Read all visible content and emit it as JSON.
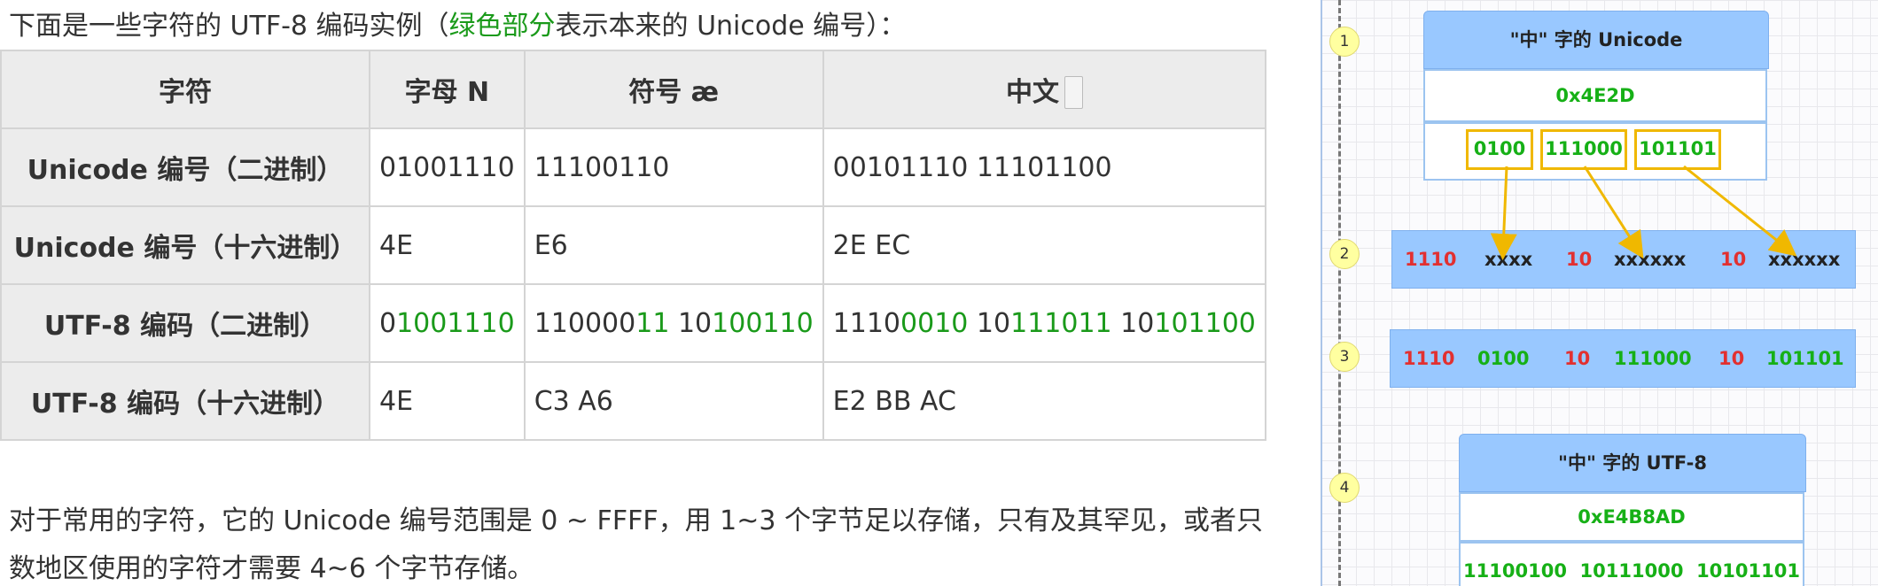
{
  "intro": {
    "before": "下面是一些字符的 UTF-8 编码实例（",
    "green": "绿色部分",
    "after": "表示本来的 Unicode 编号）："
  },
  "table": {
    "headers": [
      "字符",
      "字母 N",
      "符号 æ",
      "中文"
    ],
    "rows": [
      {
        "label": "Unicode 编号（二进制）",
        "cells": [
          [
            {
              "t": "01001110",
              "g": false
            }
          ],
          [
            {
              "t": "11100110",
              "g": false
            }
          ],
          [
            {
              "t": "00101110 11101100",
              "g": false
            }
          ]
        ]
      },
      {
        "label": "Unicode 编号（十六进制）",
        "cells": [
          [
            {
              "t": "4E",
              "g": false
            }
          ],
          [
            {
              "t": "E6",
              "g": false
            }
          ],
          [
            {
              "t": "2E EC",
              "g": false
            }
          ]
        ]
      },
      {
        "label": "UTF-8 编码（二进制）",
        "cells": [
          [
            {
              "t": "0",
              "g": false
            },
            {
              "t": "1001110",
              "g": true
            }
          ],
          [
            {
              "t": "110000",
              "g": false
            },
            {
              "t": "11",
              "g": true
            },
            {
              "t": " 10",
              "g": false
            },
            {
              "t": "100110",
              "g": true
            }
          ],
          [
            {
              "t": "1110",
              "g": false
            },
            {
              "t": "0010",
              "g": true
            },
            {
              "t": " 10",
              "g": false
            },
            {
              "t": "111011",
              "g": true
            },
            {
              "t": " 10",
              "g": false
            },
            {
              "t": "101100",
              "g": true
            }
          ]
        ]
      },
      {
        "label": "UTF-8 编码（十六进制）",
        "cells": [
          [
            {
              "t": "4E",
              "g": false
            }
          ],
          [
            {
              "t": "C3 A6",
              "g": false
            }
          ],
          [
            {
              "t": "E2 BB AC",
              "g": false
            }
          ]
        ]
      }
    ]
  },
  "paragraph": {
    "line1": "对于常用的字符，它的 Unicode 编号范围是 0 ~ FFFF，用 1~3 个字节足以存储，只有及其罕见，或者只",
    "line2": "数地区使用的字符才需要 4~6 个字节存储。"
  },
  "diagram": {
    "steps": [
      "1",
      "2",
      "3",
      "4"
    ],
    "unicode_header": "\"中\" 字的 Unicode",
    "unicode_hex": "0x4E2D",
    "unicode_groups": [
      "0100",
      "111000",
      "101101"
    ],
    "template_bar": [
      "1110",
      "xxxx",
      "10",
      "xxxxxx",
      "10",
      "xxxxxx"
    ],
    "filled_bar": [
      "1110",
      "0100",
      "10",
      "111000",
      "10",
      "101101"
    ],
    "utf8_header": "\"中\" 字的 UTF-8",
    "utf8_hex": "0xE4B8AD",
    "utf8_binary": "11100100  10111000  10101101"
  },
  "colors": {
    "green_text": "#1a9a1a",
    "diagram_green": "#16b016",
    "diagram_red": "#e23030",
    "box_blue": "#99c8ff",
    "arrow_yellow": "#f0b800"
  }
}
